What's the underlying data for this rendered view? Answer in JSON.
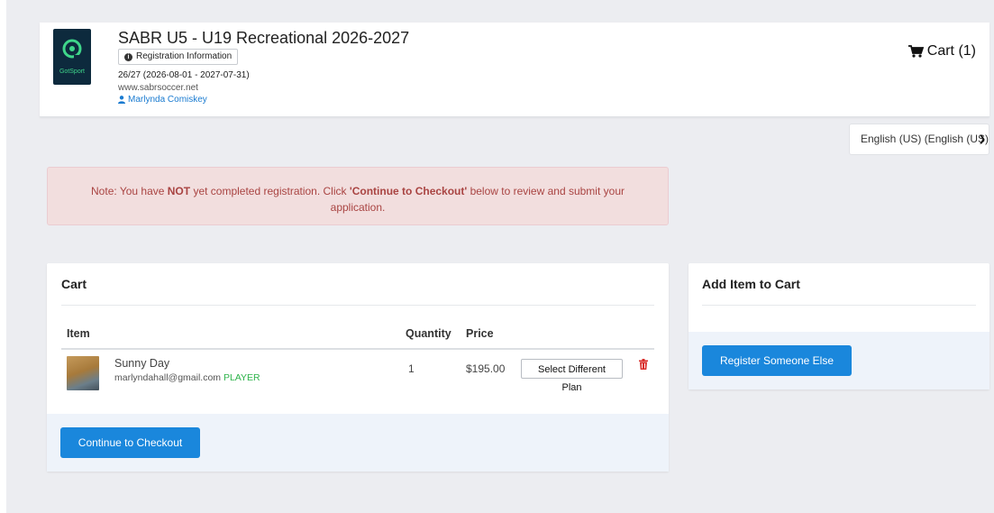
{
  "header": {
    "logo_text": "GotSport",
    "event_title": "SABR U5 - U19 Recreational 2026-2027",
    "registration_info_label": "Registration Information",
    "season": "26/27 (2026-08-01 - 2027-07-31)",
    "website": "www.sabrsoccer.net",
    "user_name": "Marlynda Comiskey",
    "cart_label": "Cart (1)"
  },
  "language": {
    "selected": "English (US) (English (US))"
  },
  "alert": {
    "prefix": "Note: You have ",
    "emphasis": "NOT",
    "middle": " yet completed registration. Click ",
    "action": "'Continue to Checkout'",
    "suffix": " below to review and submit your application."
  },
  "cart": {
    "title": "Cart",
    "columns": {
      "item": "Item",
      "quantity": "Quantity",
      "price": "Price"
    },
    "items": [
      {
        "name": "Sunny Day",
        "email": "marlyndahall@gmail.com",
        "role": "PLAYER",
        "quantity": "1",
        "price": "$195.00",
        "plan_button": "Select Different Plan"
      }
    ],
    "checkout_label": "Continue to Checkout"
  },
  "add_item": {
    "title": "Add Item to Cart",
    "register_label": "Register Someone Else"
  },
  "colors": {
    "primary": "#1a87dc",
    "alert_bg": "#f2dede",
    "alert_text": "#a94442",
    "role_green": "#2db34a",
    "link_blue": "#1a7bd0",
    "trash_red": "#d9302c"
  }
}
